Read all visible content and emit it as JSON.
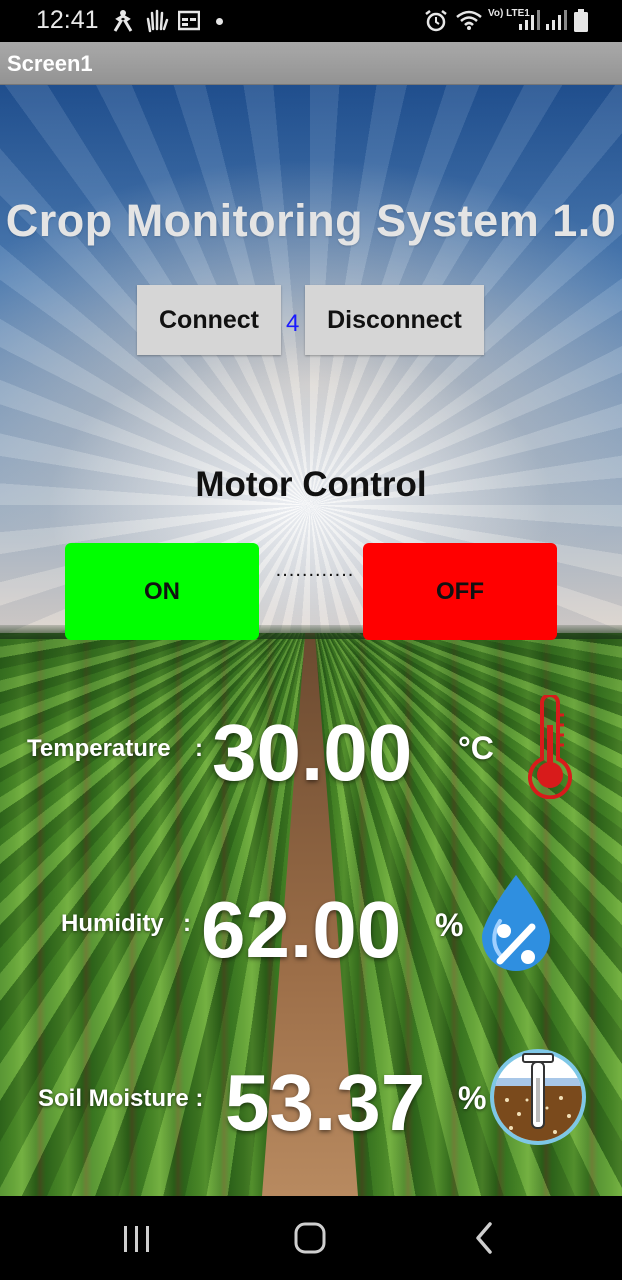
{
  "status_bar": {
    "time": "12:41",
    "lte_label": "Vo) LTE1",
    "icons": [
      "accessibility-icon",
      "hand-icon",
      "calendar-icon",
      "notification-dot",
      "alarm-icon",
      "wifi-icon",
      "signal-icon",
      "signal-icon",
      "battery-icon"
    ]
  },
  "title_bar": {
    "title": "Screen1"
  },
  "app": {
    "title": "Crop Monitoring System 1.0",
    "connect_label": "Connect",
    "disconnect_label": "Disconnect",
    "connection_count": "4"
  },
  "motor": {
    "title": "Motor Control",
    "on_label": "ON",
    "off_label": "OFF",
    "separator": "............",
    "on_color": "#00ff00",
    "off_color": "#ff0000"
  },
  "readings": {
    "temperature": {
      "label": "Temperature",
      "colon": ":",
      "value": "30.00",
      "unit": "°C",
      "icon": "thermometer-icon"
    },
    "humidity": {
      "label": "Humidity",
      "colon": ":",
      "value": "62.00",
      "unit": "%",
      "icon": "humidity-drop-icon"
    },
    "soil": {
      "label": "Soil Moisture :",
      "value": "53.37",
      "unit": "%",
      "icon": "soil-probe-icon"
    }
  },
  "nav_bar": {
    "icons": [
      "recent-apps-icon",
      "home-icon",
      "back-icon"
    ]
  }
}
